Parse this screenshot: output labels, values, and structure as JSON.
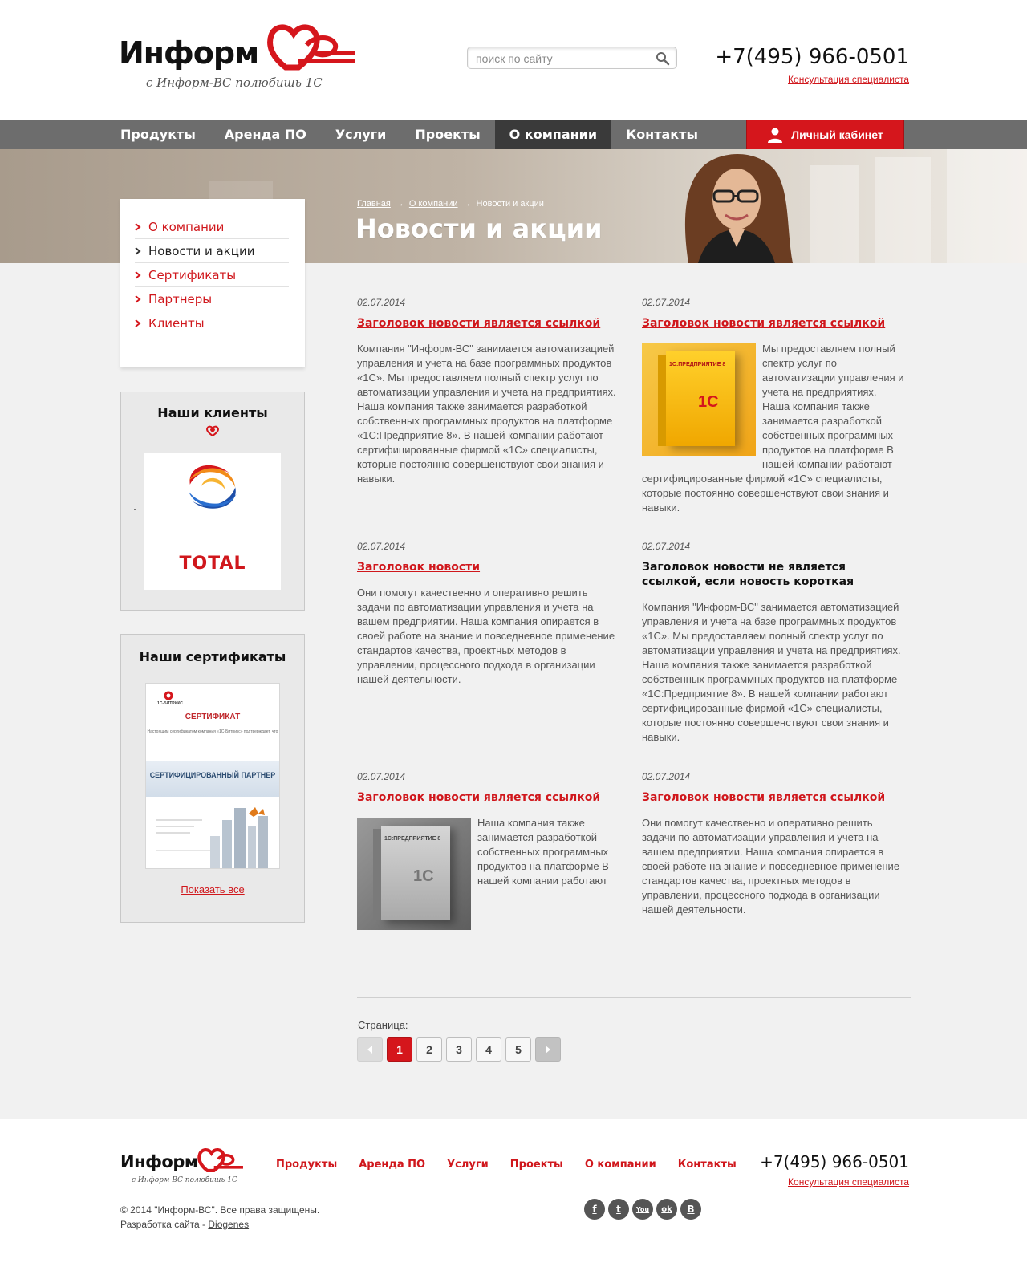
{
  "header": {
    "logo_word": "Информ",
    "logo_mark": "ВС",
    "tagline": "с Информ-ВС полюбишь 1С",
    "search_placeholder": "поиск по сайту",
    "phone": "+7(495) 966-0501",
    "consult_link": "Консультация специалиста"
  },
  "nav": {
    "items": [
      "Продукты",
      "Аренда ПО",
      "Услуги",
      "Проекты",
      "О компании",
      "Контакты"
    ],
    "active_index": 4,
    "cabinet": "Личный кабинет"
  },
  "banner": {
    "breadcrumb": [
      "Главная",
      "О компании",
      "Новости и акции"
    ],
    "title": "Новости и акции"
  },
  "sidebar": {
    "menu": [
      "О компании",
      "Новости и акции",
      "Сертификаты",
      "Партнеры",
      "Клиенты"
    ],
    "current_index": 1,
    "clients_title": "Наши клиенты",
    "client_logo_text": "TOTAL",
    "certs_title": "Наши сертификаты",
    "cert": {
      "brand": "1С-БИТРИКС",
      "heading": "СЕРТИФИКАТ",
      "sub": "Настоящим сертификатом компания «1С-Битрикс» подтверждает, что",
      "partner": "СЕРТИФИЦИРОВАННЫЙ ПАРТНЕР"
    },
    "show_all": "Показать все"
  },
  "news": [
    {
      "date": "02.07.2014",
      "title": "Заголовок новости является ссылкой",
      "is_link": true,
      "image": "",
      "text": "Компания \"Информ-ВС\" занимается автоматизацией управления и учета на базе программных продуктов «1С». Мы предоставляем полный спектр услуг по автоматизации управления и учета на предприятиях. Наша компания также занимается разработкой собственных программных продуктов на платформе «1С:Предприятие 8». В нашей компании работают сертифицированные фирмой «1С» специалисты, которые постоянно совершенствуют свои знания и навыки."
    },
    {
      "date": "02.07.2014",
      "title": "Заголовок новости является ссылкой",
      "is_link": true,
      "image": "yellow",
      "text": "Мы предоставляем полный спектр услуг по автоматизации управления и учета на предприятиях. Наша компания также занимается разработкой собственных программных продуктов на платформе В нашей компании работают сертифицированные фирмой «1С» специалисты, которые постоянно совершенствуют свои знания и навыки."
    },
    {
      "date": "02.07.2014",
      "title": "Заголовок новости",
      "is_link": true,
      "image": "",
      "text": "Они помогут качественно и оперативно решить задачи по автоматизации управления и учета на вашем предприятии. Наша компания опирается в своей работе на знание и повседневное применение стандартов качества, проектных методов в управлении, процессного подхода в организации нашей деятельности."
    },
    {
      "date": "02.07.2014",
      "title": "Заголовок новости не является ссылкой, если новость короткая",
      "is_link": false,
      "image": "",
      "text": "Компания \"Информ-ВС\" занимается автоматизацией управления и учета на базе программных продуктов «1С». Мы предоставляем полный спектр услуг по автоматизации управления и учета на предприятиях. Наша компания также занимается разработкой собственных программных продуктов на платформе «1С:Предприятие 8». В нашей компании работают сертифицированные фирмой «1С» специалисты, которые постоянно совершенствуют свои знания и навыки."
    },
    {
      "date": "02.07.2014",
      "title": "Заголовок новости является ссылкой",
      "is_link": true,
      "image": "gray",
      "text": "Наша компания также занимается разработкой собственных программных продуктов на платформе В нашей компании работают"
    },
    {
      "date": "02.07.2014",
      "title": "Заголовок новости является ссылкой",
      "is_link": true,
      "image": "",
      "text": "Они помогут качественно и оперативно решить задачи по автоматизации управления и учета на вашем предприятии. Наша компания опирается в своей работе на знание и повседневное применение стандартов качества, проектных методов в управлении, процессного подхода в организации нашей деятельности."
    }
  ],
  "product_box_label": "1С:ПРЕДПРИЯТИЕ 8",
  "product_box_brand": "1С",
  "pagination": {
    "label": "Страница:",
    "pages": [
      "1",
      "2",
      "3",
      "4",
      "5"
    ],
    "current": "1"
  },
  "footer": {
    "logo_word": "Информ",
    "logo_mark": "ВС",
    "tagline": "с Информ-ВС полюбишь 1С",
    "nav": [
      "Продукты",
      "Аренда ПО",
      "Услуги",
      "Проекты",
      "О компании",
      "Контакты"
    ],
    "phone": "+7(495) 966-0501",
    "consult_link": "Консультация специалиста",
    "copyright": "© 2014 \"Информ-ВС\". Все права защищены.",
    "dev_prefix": "Разработка сайта - ",
    "dev_name": "Diogenes",
    "socials": [
      {
        "name": "facebook-icon",
        "glyph": "f"
      },
      {
        "name": "twitter-icon",
        "glyph": "t"
      },
      {
        "name": "youtube-icon",
        "glyph": "You"
      },
      {
        "name": "odnoklassniki-icon",
        "glyph": "ok"
      },
      {
        "name": "vkontakte-icon",
        "glyph": "B"
      }
    ]
  },
  "colors": {
    "brand_red": "#d5161c",
    "nav_bg": "#6d6d6d",
    "nav_active": "#3a3a3a",
    "content_bg": "#f1f1f1"
  }
}
